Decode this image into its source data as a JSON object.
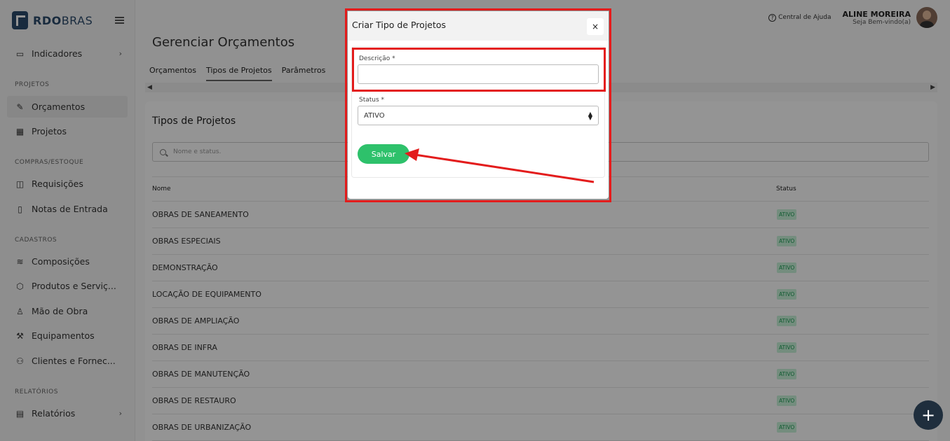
{
  "brand": {
    "part1": "RDO",
    "part2": "BRAS"
  },
  "sidebar": {
    "items": [
      {
        "label": "Indicadores",
        "icon": "monitor-icon",
        "caret": "›"
      },
      {
        "label": "Orçamentos",
        "icon": "pencil-icon"
      },
      {
        "label": "Projetos",
        "icon": "board-icon"
      },
      {
        "label": "Requisições",
        "icon": "bag-icon"
      },
      {
        "label": "Notas de Entrada",
        "icon": "file-icon"
      },
      {
        "label": "Composições",
        "icon": "layers-icon"
      },
      {
        "label": "Produtos e Serviç...",
        "icon": "box-icon"
      },
      {
        "label": "Mão de Obra",
        "icon": "user-icon"
      },
      {
        "label": "Equipamentos",
        "icon": "wrench-icon"
      },
      {
        "label": "Clientes e Fornec...",
        "icon": "users-icon"
      },
      {
        "label": "Relatórios",
        "icon": "report-icon",
        "caret": "›"
      }
    ],
    "sections": [
      "PROJETOS",
      "COMPRAS/ESTOQUE",
      "CADASTROS",
      "RELATÓRIOS"
    ]
  },
  "header": {
    "help": "Central de Ajuda",
    "user_name": "ALINE MOREIRA",
    "user_sub": "Seja Bem-vindo(a)"
  },
  "page": {
    "title": "Gerenciar Orçamentos",
    "tabs": [
      "Orçamentos",
      "Tipos de Projetos",
      "Parâmetros"
    ]
  },
  "card": {
    "title": "Tipos de Projetos",
    "search_placeholder": "Nome e status.",
    "col_name": "Nome",
    "col_status": "Status",
    "rows": [
      {
        "name": "OBRAS DE SANEAMENTO",
        "status": "ATIVO"
      },
      {
        "name": "OBRAS ESPECIAIS",
        "status": "ATIVO"
      },
      {
        "name": "DEMONSTRAÇÃO",
        "status": "ATIVO"
      },
      {
        "name": "LOCAÇÃO DE EQUIPAMENTO",
        "status": "ATIVO"
      },
      {
        "name": "OBRAS DE AMPLIAÇÃO",
        "status": "ATIVO"
      },
      {
        "name": "OBRAS DE INFRA",
        "status": "ATIVO"
      },
      {
        "name": "OBRAS DE MANUTENÇÃO",
        "status": "ATIVO"
      },
      {
        "name": "OBRAS DE RESTAURO",
        "status": "ATIVO"
      },
      {
        "name": "OBRAS DE URBANIZAÇÃO",
        "status": "ATIVO"
      }
    ]
  },
  "modal": {
    "title": "Criar Tipo de Projetos",
    "close": "×",
    "desc_label": "Descrição *",
    "desc_value": "",
    "status_label": "Status *",
    "status_value": "ATIVO",
    "save": "Salvar"
  },
  "fab": "+",
  "colors": {
    "annotation": "#e31c1c",
    "save": "#2ec16b",
    "brand": "#2b4a6b"
  }
}
